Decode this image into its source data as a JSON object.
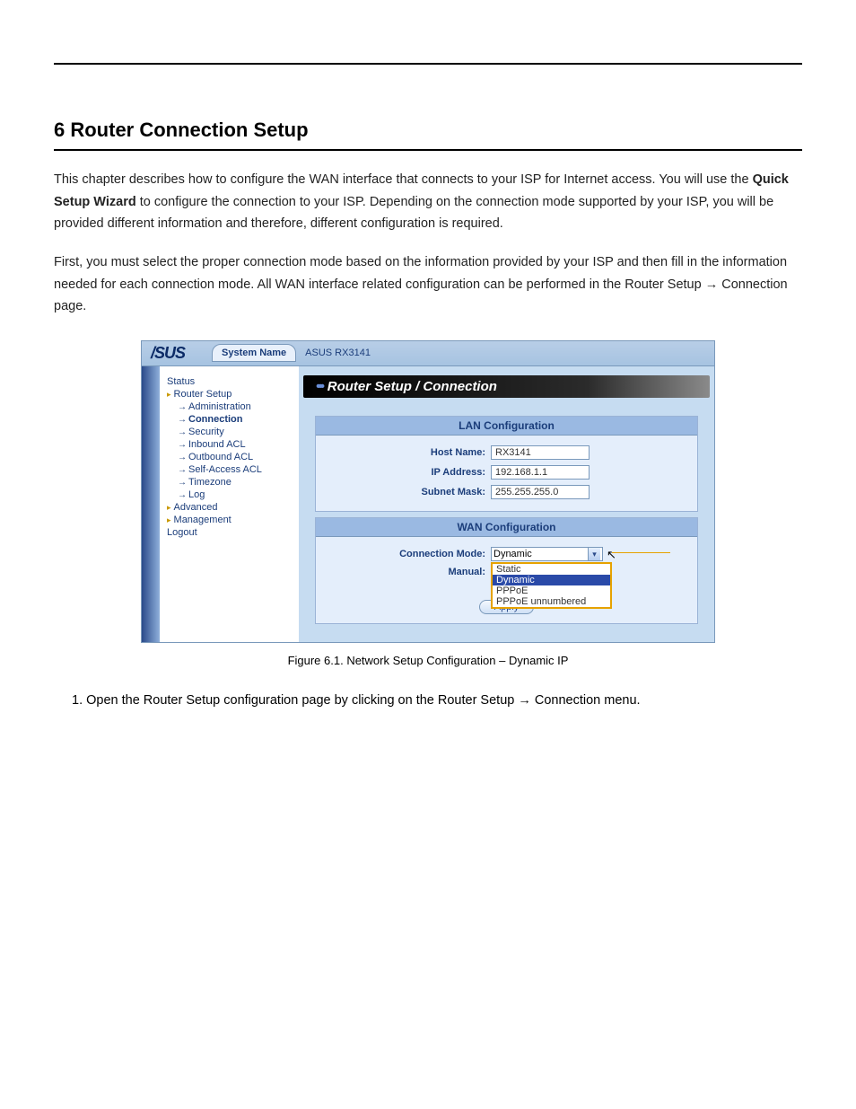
{
  "doc": {
    "heading": "6 Router Connection Setup",
    "p1_a": "This chapter describes how to configure the WAN interface that connects to your ISP for Internet access. You will use the ",
    "p1_bold": "Quick Setup Wizard",
    "p1_b": " to configure the connection to your ISP. Depending on the connection mode supported by your ISP, you will be provided different information and therefore, different configuration is required.",
    "p2_a": "First, you must select the proper connection mode based on the information provided by your ISP and then fill in the information needed for each connection mode. All WAN interface related configuration can be performed in the Router Setup ",
    "p2_arrow": "→",
    "p2_b": " Connection page.",
    "caption": "Figure 6.1. Network Setup Configuration – Dynamic IP",
    "step1": "1. Open the Router Setup configuration page by clicking on the Router Setup → Connection menu."
  },
  "ui": {
    "system_name_label": "System Name",
    "system_name_value": "ASUS RX3141",
    "logo": "/SUS",
    "nav": {
      "status": "Status",
      "router_setup": "Router Setup",
      "administration": "Administration",
      "connection": "Connection",
      "security": "Security",
      "inbound": "Inbound ACL",
      "outbound": "Outbound ACL",
      "selfaccess": "Self-Access ACL",
      "timezone": "Timezone",
      "log": "Log",
      "advanced": "Advanced",
      "management": "Management",
      "logout": "Logout"
    },
    "page_title": "Router Setup / Connection",
    "lan": {
      "header": "LAN Configuration",
      "host_label": "Host Name:",
      "host_value": "RX3141",
      "ip_label": "IP Address:",
      "ip_value": "192.168.1.1",
      "mask_label": "Subnet Mask:",
      "mask_value": "255.255.255.0"
    },
    "wan": {
      "header": "WAN Configuration",
      "mode_label": "Connection Mode:",
      "mode_value": "Dynamic",
      "manual_label": "Manual:",
      "options": {
        "static": "Static",
        "dynamic": "Dynamic",
        "pppoe": "PPPoE",
        "pppoe_un": "PPPoE unnumbered"
      },
      "apply": "Apply"
    }
  }
}
